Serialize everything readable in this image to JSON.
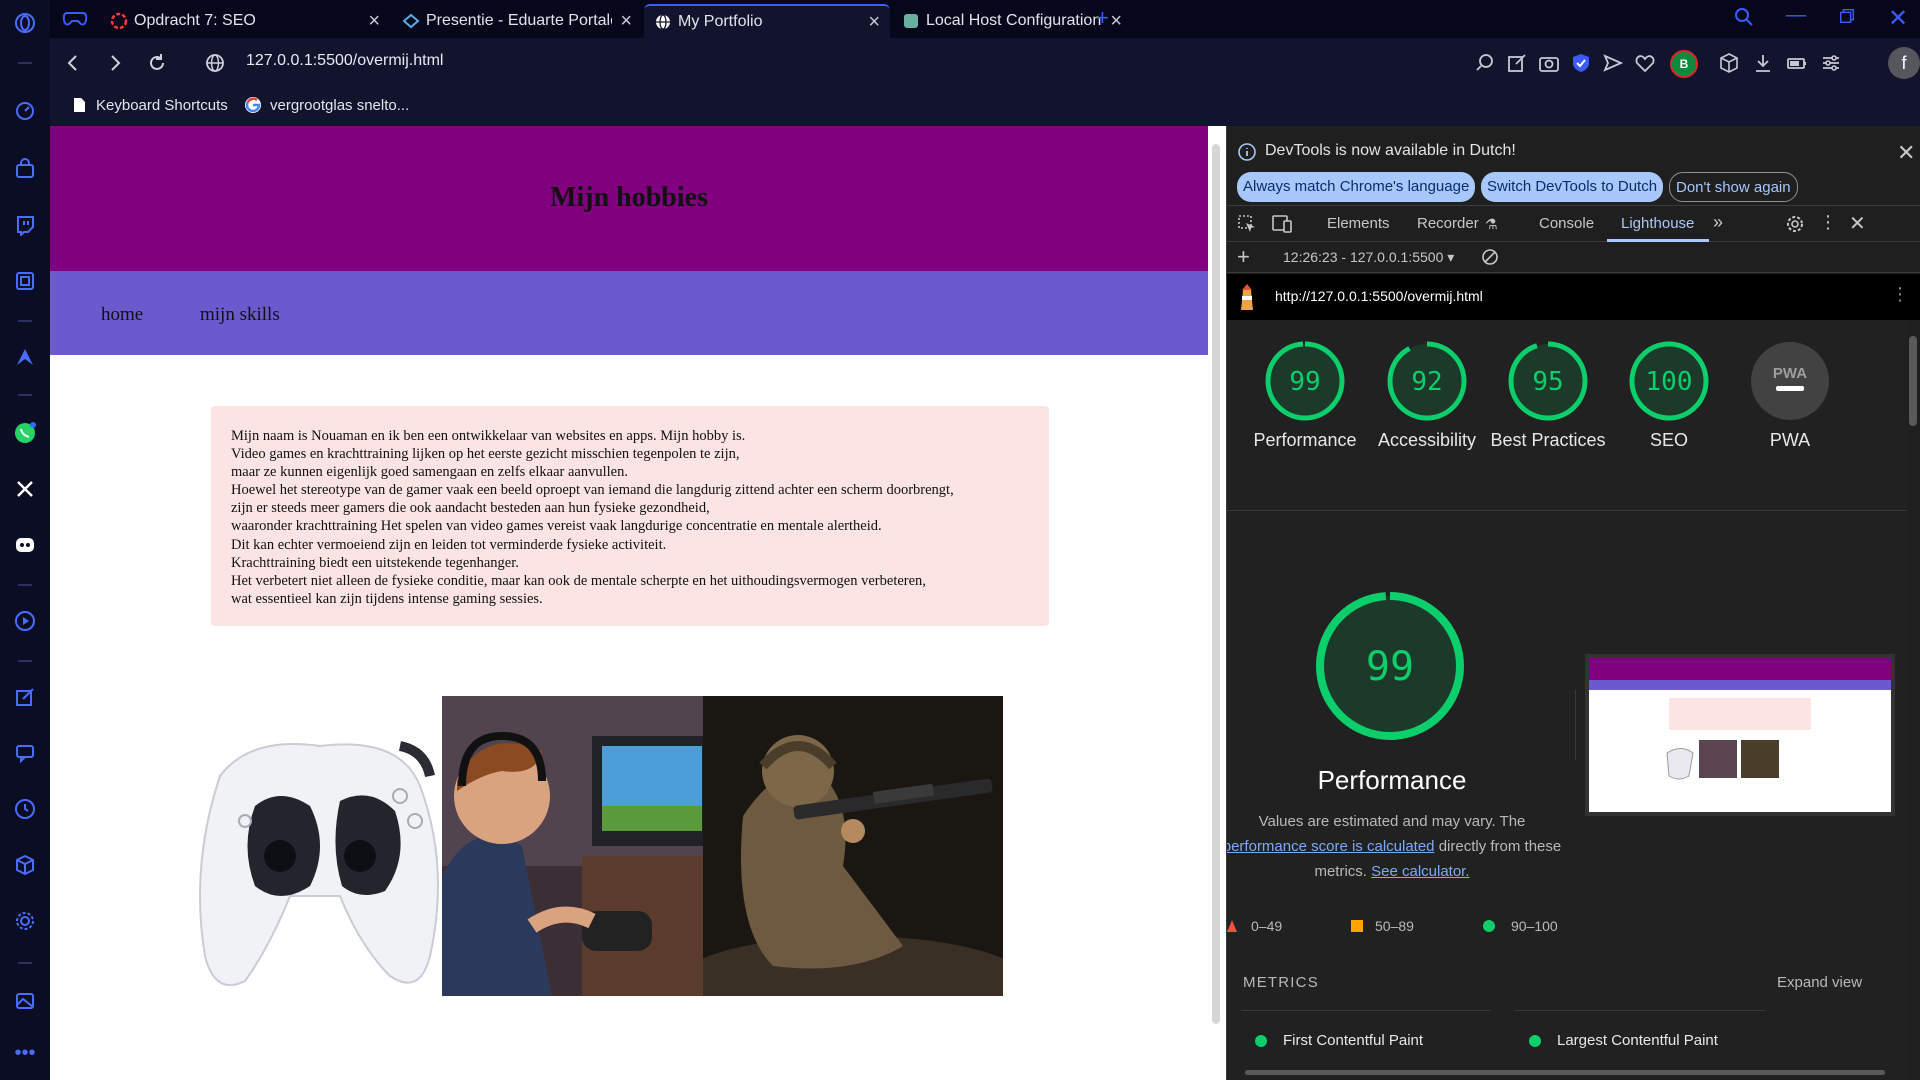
{
  "browser": {
    "tabs": [
      {
        "title": "Opdracht 7: SEO"
      },
      {
        "title": "Presentie - Eduarte Portalen"
      },
      {
        "title": "My Portfolio"
      },
      {
        "title": "Local Host Configurations"
      }
    ],
    "url": "127.0.0.1:5500/overmij.html",
    "profile_initial": "f",
    "extension_badge": "B",
    "bookmarks": [
      {
        "label": "Keyboard Shortcuts"
      },
      {
        "label": "vergrootglas snelto..."
      }
    ]
  },
  "page": {
    "title": "Mijn hobbies",
    "nav": [
      "home",
      "mijn skills"
    ],
    "about_lines": [
      "Mijn naam is Nouaman en ik ben een ontwikkelaar van websites en apps. Mijn hobby is.",
      "Video games en krachttraining lijken op het eerste gezicht misschien tegenpolen te zijn,",
      "maar ze kunnen eigenlijk goed samengaan en zelfs elkaar aanvullen.",
      "Hoewel het stereotype van de gamer vaak een beeld oproept van iemand die langdurig zittend achter een scherm doorbrengt,",
      "zijn er steeds meer gamers die ook aandacht besteden aan hun fysieke gezondheid,",
      "waaronder krachttraining Het spelen van video games vereist vaak langdurige concentratie en mentale alertheid.",
      "Dit kan echter vermoeiend zijn en leiden tot verminderde fysieke activiteit.",
      "Krachttraining biedt een uitstekende tegenhanger.",
      "Het verbetert niet alleen de fysieke conditie, maar kan ook de mentale scherpte en het uithoudingsvermogen verbeteren,",
      "wat essentieel kan zijn tijdens intense gaming sessies."
    ]
  },
  "devtools": {
    "infobar": {
      "message": "DevTools is now available in Dutch!",
      "btn_match": "Always match Chrome's language",
      "btn_switch": "Switch DevTools to Dutch",
      "btn_dismiss": "Don't show again"
    },
    "tabs": [
      "Elements",
      "Recorder",
      "Console",
      "Lighthouse"
    ],
    "active_tab": "Lighthouse",
    "report_selector": "12:26:23 - 127.0.0.1:5500",
    "report_url": "http://127.0.0.1:5500/overmij.html",
    "scores": [
      {
        "label": "Performance",
        "value": 99
      },
      {
        "label": "Accessibility",
        "value": 92
      },
      {
        "label": "Best Practices",
        "value": 95
      },
      {
        "label": "SEO",
        "value": 100
      },
      {
        "label": "PWA",
        "value": null
      }
    ],
    "pwa_badge": "PWA",
    "main_score": "99",
    "main_label": "Performance",
    "desc_1": "Values are estimated and may vary. The",
    "desc_link_1": "performance score is calculated",
    "desc_2": "directly from these metrics.",
    "desc_link_2": "See calculator.",
    "legend": [
      "0–49",
      "50–89",
      "90–100"
    ],
    "metrics_title": "METRICS",
    "expand_label": "Expand view",
    "metrics": [
      "First Contentful Paint",
      "Largest Contentful Paint"
    ],
    "colors": {
      "pass": "#0cce6b",
      "average": "#ffa400",
      "fail": "#ff4e42"
    }
  }
}
